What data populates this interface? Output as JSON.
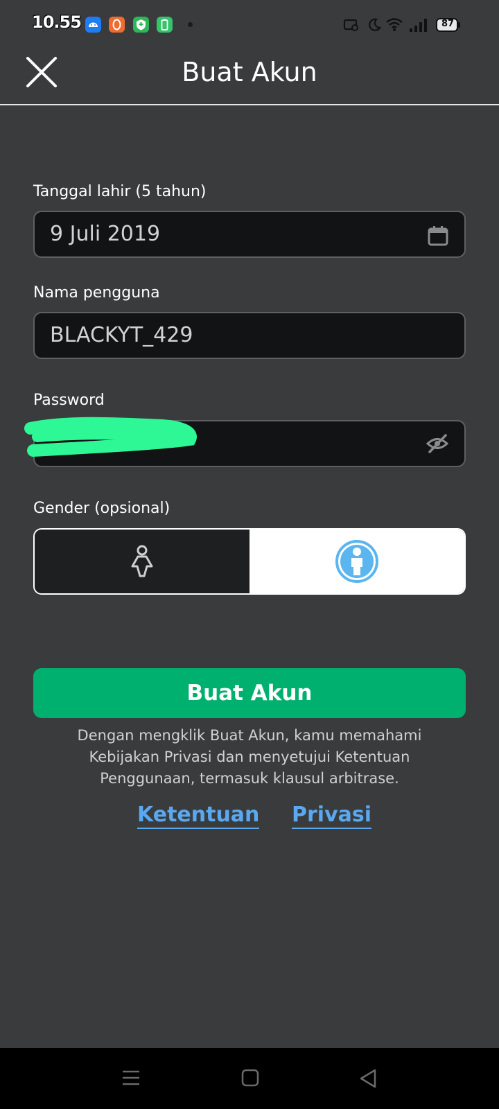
{
  "status": {
    "time": "10.55",
    "battery": "87",
    "icons": [
      "android-icon",
      "orange-app-icon",
      "shield-app-icon",
      "battery-app-icon",
      "notification-dot",
      "screencast-icon",
      "moon-icon",
      "wifi-icon",
      "signal-icon",
      "battery-icon"
    ]
  },
  "header": {
    "title": "Buat Akun",
    "close_icon": "close-icon"
  },
  "form": {
    "birthdate": {
      "label": "Tanggal lahir (5 tahun)",
      "value": "9 Juli 2019",
      "icon": "calendar-icon"
    },
    "username": {
      "label": "Nama pengguna",
      "value": "BLACKYT_429"
    },
    "password": {
      "label": "Password",
      "value": "",
      "icon": "eye-off-icon"
    },
    "gender": {
      "label": "Gender (opsional)",
      "options": [
        "female-icon",
        "male-icon"
      ],
      "selected": "male-icon"
    }
  },
  "cta": {
    "label": "Buat Akun",
    "color": "#00b06f"
  },
  "legal": {
    "text": "Dengan mengklik Buat Akun, kamu memahami Kebijakan Privasi dan menyetujui Ketentuan Penggunaan, termasuk klausul arbitrase.",
    "terms_link": "Ketentuan",
    "privacy_link": "Privasi",
    "link_color": "#5aa8f0"
  },
  "navbar": {
    "icons": [
      "menu-icon",
      "home-square-icon",
      "back-triangle-icon"
    ]
  }
}
